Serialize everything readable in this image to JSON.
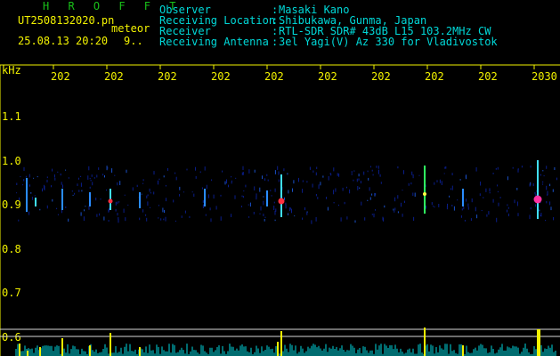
{
  "header": {
    "station": "H R O F F T",
    "filename": "UT2508132020.pn",
    "meteor_label": "meteor",
    "datetime": "25.08.13 20:20",
    "count": "9..",
    "info": [
      {
        "label": "Observer",
        "value": "Masaki Kano"
      },
      {
        "label": "Receiving Location",
        "value": "Shibukawa, Gunma, Japan"
      },
      {
        "label": "Receiver",
        "value": "RTL-SDR SDR# 43dB L15 103.2MHz CW"
      },
      {
        "label": "Receiving Antenna",
        "value": "3el Yagi(V) Az 330 for Vladivostok"
      }
    ]
  },
  "axis": {
    "unit": "kHz",
    "y_ticks": [
      "1.1",
      "1.0",
      "0.9",
      "0.8",
      "0.7",
      "0.6"
    ],
    "x_ticks": [
      "202",
      "202",
      "202",
      "202",
      "202",
      "202",
      "202",
      "202",
      "202",
      "2030"
    ]
  },
  "colors": {
    "text": "#f2f200",
    "label": "#00d8d8",
    "station": "#19c019",
    "noise_bar": "#00d8e0",
    "meteor_bar": "#f2f200"
  }
}
